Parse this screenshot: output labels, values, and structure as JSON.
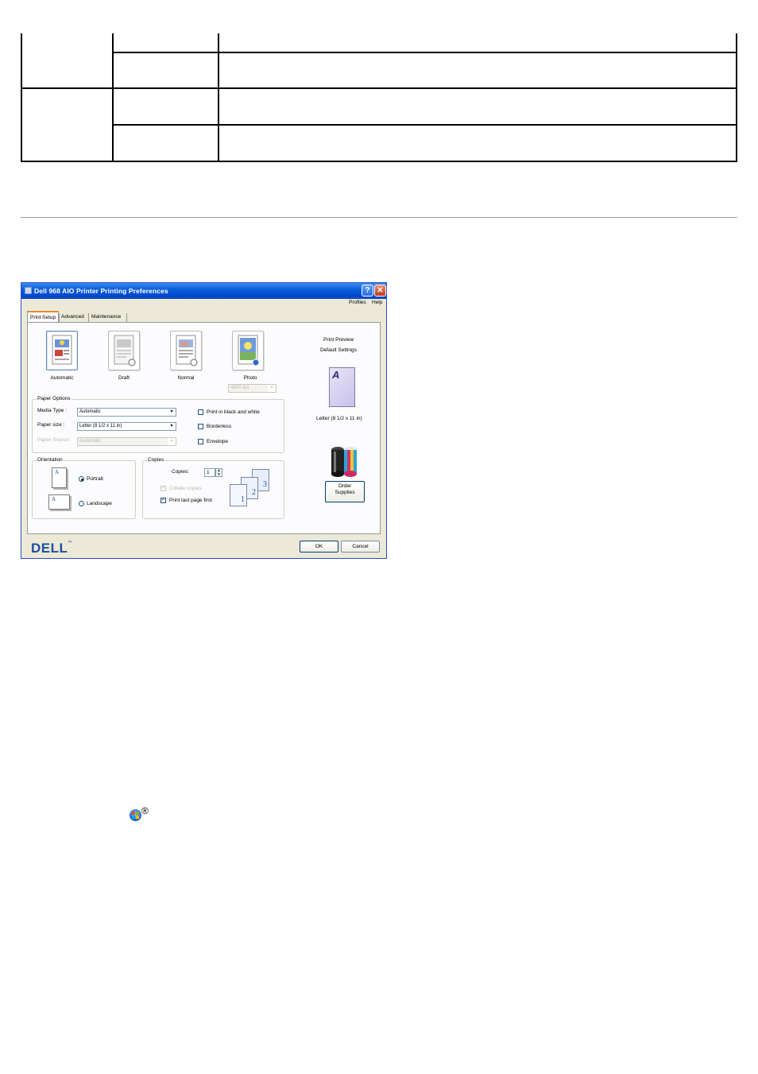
{
  "dialog": {
    "title": "Dell 968 AIO Printer Printing Preferences",
    "help_button": "?",
    "close_button": "✕",
    "menu": {
      "profiles": "Profiles",
      "help": "Help"
    },
    "tabs": [
      {
        "label": "Print Setup",
        "active": true
      },
      {
        "label": "Advanced",
        "active": false
      },
      {
        "label": "Maintenance",
        "active": false
      }
    ],
    "quality": [
      {
        "label": "Automatic",
        "selected": true,
        "icon": "automatic-quality-icon"
      },
      {
        "label": "Draft",
        "selected": false,
        "icon": "draft-quality-icon"
      },
      {
        "label": "Normal",
        "selected": false,
        "icon": "normal-quality-icon"
      },
      {
        "label": "Photo",
        "selected": false,
        "icon": "photo-quality-icon"
      }
    ],
    "photo_dpi": "4800 dpi",
    "paper_options": {
      "title": "Paper Options",
      "media_type_label": "Media Type :",
      "media_type_value": "Automatic",
      "paper_size_label": "Paper size :",
      "paper_size_value": "Letter (8 1/2 x 11 in)",
      "paper_source_label": "Paper Source :",
      "paper_source_value": "Automatic",
      "print_bw_label": "Print in black and white",
      "borderless_label": "Borderless",
      "envelope_label": "Envelope"
    },
    "orientation": {
      "title": "Orientation",
      "portrait_label": "Portrait",
      "landscape_label": "Landscape",
      "selected": "Portrait",
      "page_letter": "A"
    },
    "copies": {
      "title": "Copies",
      "copies_label": "Copies:",
      "copies_value": "1",
      "collate_label": "Collate copies",
      "collate_checked": true,
      "last_page_first_label": "Print last page first",
      "last_page_first_checked": true,
      "page_numbers": [
        "1",
        "2",
        "3"
      ]
    },
    "preview": {
      "title_line1": "Print Preview",
      "title_line2": "Default Settings",
      "page_letter": "A",
      "paper_label": "Letter (8 1/2 x 11 in)"
    },
    "order_supplies_line1": "Order",
    "order_supplies_line2": "Supplies",
    "ok_label": "OK",
    "cancel_label": "Cancel",
    "logo_text": "DELL",
    "logo_tm": "™"
  },
  "footnote": {
    "icon": "windows-start-icon",
    "registered_mark": "®"
  },
  "colors": {
    "title_bar": "#0a5fd9",
    "dialog_bg": "#ece9d8",
    "panel_bg": "#fcfcfe",
    "tab_highlight": "#e68b2c",
    "dell_blue": "#1c4fa0"
  }
}
